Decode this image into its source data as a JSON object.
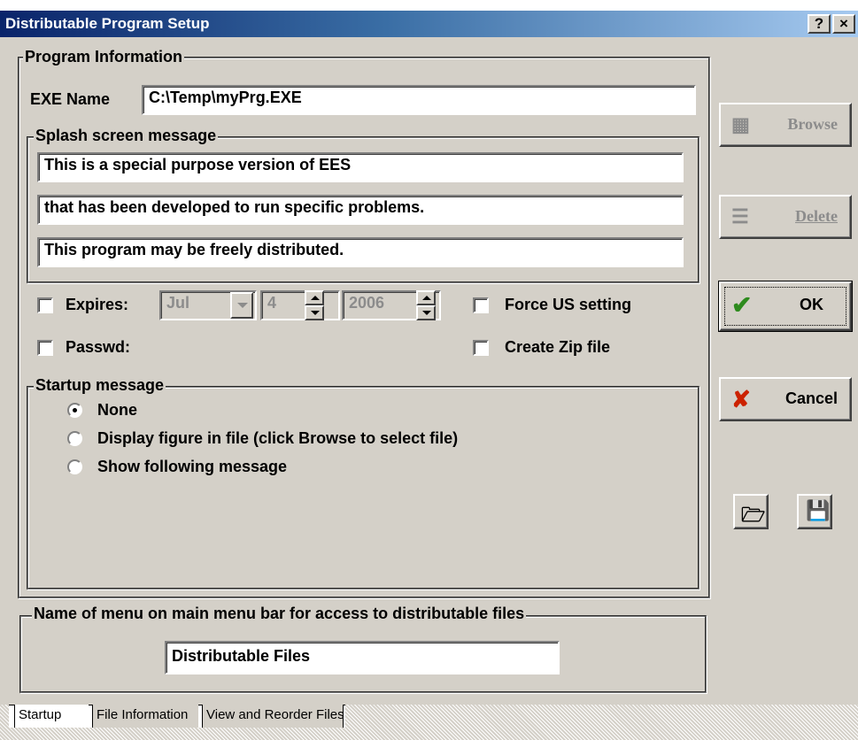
{
  "window": {
    "title": "Distributable Program Setup",
    "help_button": "?",
    "close_button": "×"
  },
  "program_info": {
    "legend": "Program Information",
    "exe_label": "EXE Name",
    "exe_value": "C:\\Temp\\myPrg.EXE",
    "splash": {
      "legend": "Splash screen message",
      "lines": [
        "This is a special purpose version of EES",
        "that has been developed to run specific problems.",
        "This program may be freely distributed."
      ]
    }
  },
  "options": {
    "expires_label": "Expires:",
    "expires_checked": false,
    "month": "Jul",
    "day": "4",
    "year": "2006",
    "force_us_label": "Force US setting",
    "force_us_checked": false,
    "passwd_label": "Passwd:",
    "passwd_checked": false,
    "create_zip_label": "Create Zip file",
    "create_zip_checked": false
  },
  "startup_message": {
    "legend": "Startup message",
    "options": [
      {
        "label": "None",
        "selected": true
      },
      {
        "label": "Display figure in file  (click Browse to select file)",
        "selected": false
      },
      {
        "label": "Show following message",
        "selected": false
      }
    ]
  },
  "menu_name": {
    "legend": "Name of menu on main menu bar for access to  distributable files",
    "value": "Distributable Files"
  },
  "buttons": {
    "browse": "Browse",
    "delete": "Delete",
    "ok": "OK",
    "cancel": "Cancel"
  },
  "tabs": [
    "Startup",
    "File Information",
    "View and Reorder Files"
  ],
  "colors": {
    "title_start": "#0a246a",
    "title_end": "#a6caf0",
    "face": "#d4d0c8",
    "ok_check": "#2e8b1e",
    "cancel_x": "#cc2200"
  }
}
